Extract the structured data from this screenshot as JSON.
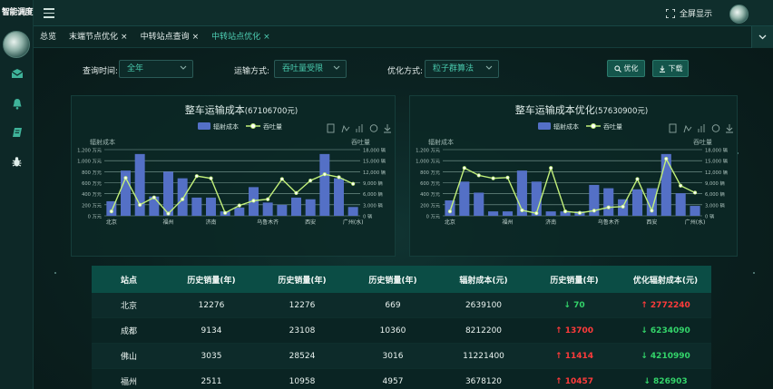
{
  "app": {
    "brand": "智能调度",
    "fullscreen_label": "全屏显示"
  },
  "tabs": [
    {
      "label": "总览",
      "closable": false,
      "active": false
    },
    {
      "label": "末端节点优化",
      "closable": true,
      "active": false
    },
    {
      "label": "中转站点查询",
      "closable": true,
      "active": false
    },
    {
      "label": "中转站点优化",
      "closable": true,
      "active": true
    }
  ],
  "tab_close_glyph": "×",
  "filters": {
    "time_label": "查询时间:",
    "time_value": "全年",
    "mode_label": "运输方式:",
    "mode_value": "吞吐量受限",
    "algo_label": "优化方式:",
    "algo_value": "粒子群算法",
    "optimize_button": "优化",
    "download_button": "下载"
  },
  "charts": [
    {
      "title": "整车运输成本",
      "title_value": "(67106700元)",
      "legend_bar": "辐射成本",
      "legend_line": "吞吐量",
      "ylabel_left": "辐射成本",
      "ylabel_right": "吞吐量",
      "yticks_left": [
        "1,200 万元",
        "1,000 万元",
        "800 万元",
        "600 万元",
        "400 万元",
        "200 万元",
        "0 万元"
      ],
      "yticks_right": [
        "18,000 辆",
        "15,000 辆",
        "12,000 辆",
        "9,000 辆",
        "6,000 辆",
        "3,000 辆",
        "0 辆"
      ],
      "xticks": [
        {
          "i": 0,
          "label": "北京"
        },
        {
          "i": 4,
          "label": "福州"
        },
        {
          "i": 7,
          "label": "济南"
        },
        {
          "i": 11,
          "label": "乌鲁木齐"
        },
        {
          "i": 14,
          "label": "西安"
        },
        {
          "i": 17,
          "label": "广州(水)"
        }
      ]
    },
    {
      "title": "整车运输成本优化",
      "title_value": "(57630900元)",
      "legend_bar": "辐射成本",
      "legend_line": "吞吐量",
      "ylabel_left": "辐射成本",
      "ylabel_right": "吞吐量",
      "yticks_left": [
        "1,200 万元",
        "1,000 万元",
        "800 万元",
        "600 万元",
        "400 万元",
        "200 万元",
        "0 万元"
      ],
      "yticks_right": [
        "18,000 辆",
        "15,000 辆",
        "12,000 辆",
        "9,000 辆",
        "6,000 辆",
        "3,000 辆",
        "0 辆"
      ],
      "xticks": [
        {
          "i": 0,
          "label": "北京"
        },
        {
          "i": 4,
          "label": "福州"
        },
        {
          "i": 7,
          "label": "济南"
        },
        {
          "i": 11,
          "label": "乌鲁木齐"
        },
        {
          "i": 14,
          "label": "西安"
        },
        {
          "i": 17,
          "label": "广州(水)"
        }
      ]
    }
  ],
  "chart_data": [
    {
      "type": "bar",
      "title": "整车运输成本(67106700元)",
      "ylim_left": [
        0,
        1200
      ],
      "ylim_right": [
        0,
        18000
      ],
      "series": [
        {
          "name": "辐射成本",
          "axis": "left",
          "values": [
            264,
            820,
            1120,
            350,
            800,
            680,
            330,
            330,
            80,
            150,
            520,
            240,
            200,
            330,
            300,
            1120,
            680,
            160
          ]
        },
        {
          "name": "吞吐量",
          "axis": "right",
          "values": [
            1200,
            10300,
            3000,
            5000,
            600,
            4500,
            10800,
            10200,
            800,
            2800,
            4100,
            4500,
            10000,
            6200,
            9600,
            11300,
            10500,
            8700
          ]
        }
      ]
    },
    {
      "type": "bar",
      "title": "整车运输成本优化(57630900元)",
      "ylim_left": [
        0,
        1200
      ],
      "ylim_right": [
        0,
        18000
      ],
      "series": [
        {
          "name": "辐射成本",
          "axis": "left",
          "values": [
            280,
            620,
            420,
            80,
            80,
            820,
            620,
            80,
            80,
            80,
            560,
            500,
            300,
            480,
            500,
            1120,
            410,
            180
          ]
        },
        {
          "name": "吞吐量",
          "axis": "right",
          "values": [
            1200,
            13000,
            11000,
            10200,
            10400,
            1500,
            700,
            13000,
            1200,
            800,
            1400,
            2300,
            2500,
            10000,
            1400,
            15500,
            8200,
            6300
          ]
        }
      ]
    }
  ],
  "table": {
    "headers": [
      "站点",
      "历史销量(年)",
      "历史销量(年)",
      "历史销量(年)",
      "辐射成本(元)",
      "历史销量(年)",
      "优化辐射成本(元)"
    ],
    "rows": [
      {
        "cells": [
          "北京",
          "12276",
          "12276",
          "669",
          "2639100"
        ],
        "delta": "70",
        "delta_dir": "down",
        "opt": "2772240",
        "opt_dir": "up"
      },
      {
        "cells": [
          "成都",
          "9134",
          "23108",
          "10360",
          "8212200"
        ],
        "delta": "13700",
        "delta_dir": "up",
        "opt": "6234090",
        "opt_dir": "down"
      },
      {
        "cells": [
          "佛山",
          "3035",
          "28524",
          "3016",
          "11221400"
        ],
        "delta": "11414",
        "delta_dir": "up",
        "opt": "4210990",
        "opt_dir": "down"
      },
      {
        "cells": [
          "福州",
          "2511",
          "10958",
          "4957",
          "3678120"
        ],
        "delta": "10457",
        "delta_dir": "up",
        "opt": "826903",
        "opt_dir": "down"
      }
    ]
  },
  "colors": {
    "accent": "#4fd1b6",
    "bar": "#5470c6",
    "line": "#c2f07a",
    "up": "#ff3b3b",
    "down": "#33d46a"
  },
  "icons": {
    "up": "↑",
    "down": "↓"
  }
}
